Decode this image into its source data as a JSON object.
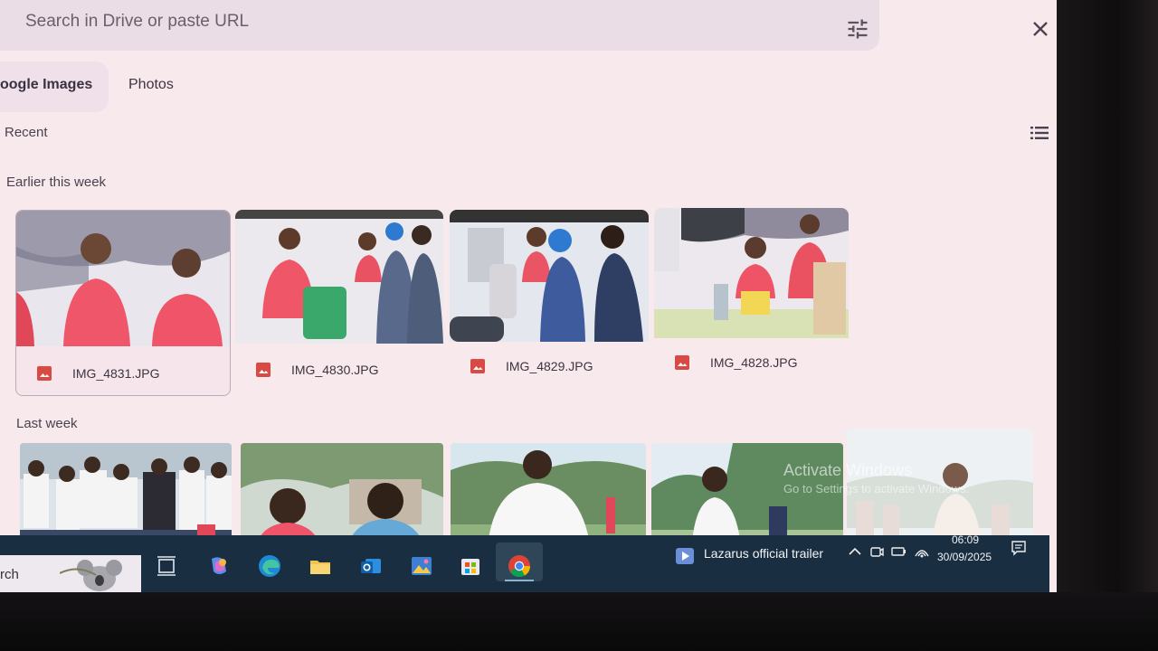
{
  "search": {
    "placeholder": "Search in Drive or paste URL"
  },
  "tabs": [
    {
      "label": "oogle Images"
    },
    {
      "label": "Photos"
    }
  ],
  "recent_label": "Recent",
  "sections": {
    "earlier": "Earlier this week",
    "last_week": "Last week"
  },
  "files": [
    {
      "name": "IMG_4831.JPG"
    },
    {
      "name": "IMG_4830.JPG"
    },
    {
      "name": "IMG_4829.JPG"
    },
    {
      "name": "IMG_4828.JPG"
    }
  ],
  "watermark": {
    "title": "Activate Windows",
    "subtitle": "Go to Settings to activate Windows."
  },
  "taskbar": {
    "search_text": "rch",
    "media_title": "Lazarus official trailer",
    "time": "06:09",
    "date": "30/09/2025"
  },
  "colors": {
    "screen_bg": "#f8e9ec",
    "taskbar": "#1a2e42",
    "file_icon_red": "#d94a44"
  }
}
